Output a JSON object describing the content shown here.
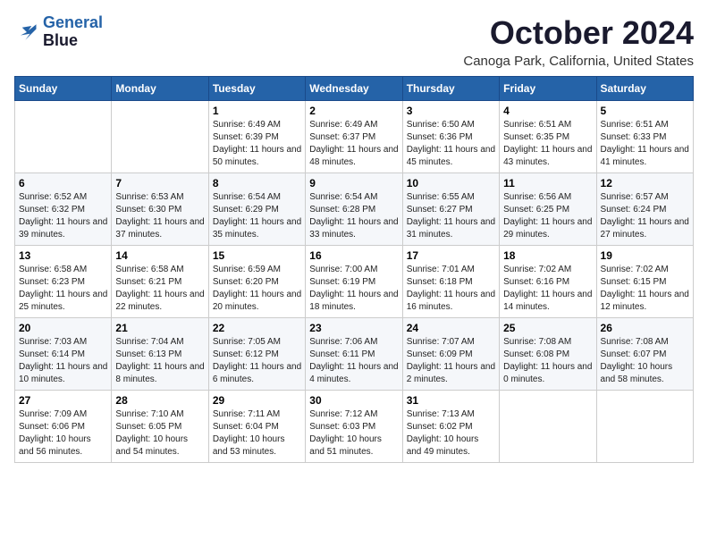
{
  "header": {
    "logo_line1": "General",
    "logo_line2": "Blue",
    "month": "October 2024",
    "location": "Canoga Park, California, United States"
  },
  "days_of_week": [
    "Sunday",
    "Monday",
    "Tuesday",
    "Wednesday",
    "Thursday",
    "Friday",
    "Saturday"
  ],
  "weeks": [
    [
      {
        "day": "",
        "content": ""
      },
      {
        "day": "",
        "content": ""
      },
      {
        "day": "1",
        "content": "Sunrise: 6:49 AM\nSunset: 6:39 PM\nDaylight: 11 hours and 50 minutes."
      },
      {
        "day": "2",
        "content": "Sunrise: 6:49 AM\nSunset: 6:37 PM\nDaylight: 11 hours and 48 minutes."
      },
      {
        "day": "3",
        "content": "Sunrise: 6:50 AM\nSunset: 6:36 PM\nDaylight: 11 hours and 45 minutes."
      },
      {
        "day": "4",
        "content": "Sunrise: 6:51 AM\nSunset: 6:35 PM\nDaylight: 11 hours and 43 minutes."
      },
      {
        "day": "5",
        "content": "Sunrise: 6:51 AM\nSunset: 6:33 PM\nDaylight: 11 hours and 41 minutes."
      }
    ],
    [
      {
        "day": "6",
        "content": "Sunrise: 6:52 AM\nSunset: 6:32 PM\nDaylight: 11 hours and 39 minutes."
      },
      {
        "day": "7",
        "content": "Sunrise: 6:53 AM\nSunset: 6:30 PM\nDaylight: 11 hours and 37 minutes."
      },
      {
        "day": "8",
        "content": "Sunrise: 6:54 AM\nSunset: 6:29 PM\nDaylight: 11 hours and 35 minutes."
      },
      {
        "day": "9",
        "content": "Sunrise: 6:54 AM\nSunset: 6:28 PM\nDaylight: 11 hours and 33 minutes."
      },
      {
        "day": "10",
        "content": "Sunrise: 6:55 AM\nSunset: 6:27 PM\nDaylight: 11 hours and 31 minutes."
      },
      {
        "day": "11",
        "content": "Sunrise: 6:56 AM\nSunset: 6:25 PM\nDaylight: 11 hours and 29 minutes."
      },
      {
        "day": "12",
        "content": "Sunrise: 6:57 AM\nSunset: 6:24 PM\nDaylight: 11 hours and 27 minutes."
      }
    ],
    [
      {
        "day": "13",
        "content": "Sunrise: 6:58 AM\nSunset: 6:23 PM\nDaylight: 11 hours and 25 minutes."
      },
      {
        "day": "14",
        "content": "Sunrise: 6:58 AM\nSunset: 6:21 PM\nDaylight: 11 hours and 22 minutes."
      },
      {
        "day": "15",
        "content": "Sunrise: 6:59 AM\nSunset: 6:20 PM\nDaylight: 11 hours and 20 minutes."
      },
      {
        "day": "16",
        "content": "Sunrise: 7:00 AM\nSunset: 6:19 PM\nDaylight: 11 hours and 18 minutes."
      },
      {
        "day": "17",
        "content": "Sunrise: 7:01 AM\nSunset: 6:18 PM\nDaylight: 11 hours and 16 minutes."
      },
      {
        "day": "18",
        "content": "Sunrise: 7:02 AM\nSunset: 6:16 PM\nDaylight: 11 hours and 14 minutes."
      },
      {
        "day": "19",
        "content": "Sunrise: 7:02 AM\nSunset: 6:15 PM\nDaylight: 11 hours and 12 minutes."
      }
    ],
    [
      {
        "day": "20",
        "content": "Sunrise: 7:03 AM\nSunset: 6:14 PM\nDaylight: 11 hours and 10 minutes."
      },
      {
        "day": "21",
        "content": "Sunrise: 7:04 AM\nSunset: 6:13 PM\nDaylight: 11 hours and 8 minutes."
      },
      {
        "day": "22",
        "content": "Sunrise: 7:05 AM\nSunset: 6:12 PM\nDaylight: 11 hours and 6 minutes."
      },
      {
        "day": "23",
        "content": "Sunrise: 7:06 AM\nSunset: 6:11 PM\nDaylight: 11 hours and 4 minutes."
      },
      {
        "day": "24",
        "content": "Sunrise: 7:07 AM\nSunset: 6:09 PM\nDaylight: 11 hours and 2 minutes."
      },
      {
        "day": "25",
        "content": "Sunrise: 7:08 AM\nSunset: 6:08 PM\nDaylight: 11 hours and 0 minutes."
      },
      {
        "day": "26",
        "content": "Sunrise: 7:08 AM\nSunset: 6:07 PM\nDaylight: 10 hours and 58 minutes."
      }
    ],
    [
      {
        "day": "27",
        "content": "Sunrise: 7:09 AM\nSunset: 6:06 PM\nDaylight: 10 hours and 56 minutes."
      },
      {
        "day": "28",
        "content": "Sunrise: 7:10 AM\nSunset: 6:05 PM\nDaylight: 10 hours and 54 minutes."
      },
      {
        "day": "29",
        "content": "Sunrise: 7:11 AM\nSunset: 6:04 PM\nDaylight: 10 hours and 53 minutes."
      },
      {
        "day": "30",
        "content": "Sunrise: 7:12 AM\nSunset: 6:03 PM\nDaylight: 10 hours and 51 minutes."
      },
      {
        "day": "31",
        "content": "Sunrise: 7:13 AM\nSunset: 6:02 PM\nDaylight: 10 hours and 49 minutes."
      },
      {
        "day": "",
        "content": ""
      },
      {
        "day": "",
        "content": ""
      }
    ]
  ]
}
